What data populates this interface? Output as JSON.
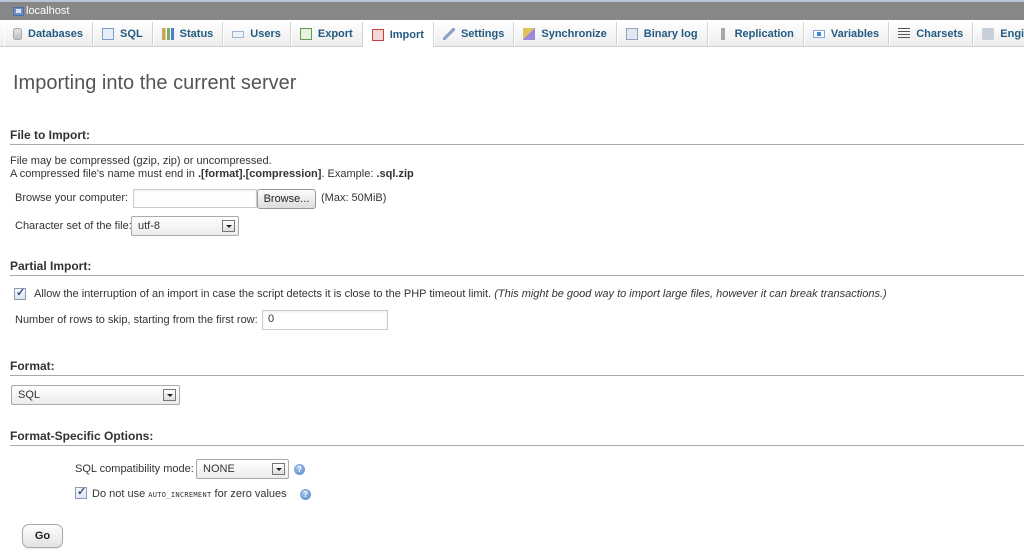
{
  "window": {
    "server_label": "localhost"
  },
  "tabs": [
    {
      "label": "Databases",
      "icon": "database-icon",
      "active": false
    },
    {
      "label": "SQL",
      "icon": "sql-icon",
      "active": false
    },
    {
      "label": "Status",
      "icon": "status-chart-icon",
      "active": false
    },
    {
      "label": "Users",
      "icon": "users-icon",
      "active": false
    },
    {
      "label": "Export",
      "icon": "export-icon",
      "active": false
    },
    {
      "label": "Import",
      "icon": "import-icon",
      "active": true
    },
    {
      "label": "Settings",
      "icon": "wrench-icon",
      "active": false
    },
    {
      "label": "Synchronize",
      "icon": "synchronize-icon",
      "active": false
    },
    {
      "label": "Binary log",
      "icon": "binary-log-icon",
      "active": false
    },
    {
      "label": "Replication",
      "icon": "replication-icon",
      "active": false
    },
    {
      "label": "Variables",
      "icon": "variables-icon",
      "active": false
    },
    {
      "label": "Charsets",
      "icon": "charsets-icon",
      "active": false
    },
    {
      "label": "Engines",
      "icon": "engines-icon",
      "active": false
    }
  ],
  "page": {
    "title": "Importing into the current server"
  },
  "file_to_import": {
    "heading": "File to Import:",
    "line1": "File may be compressed (gzip, zip) or uncompressed.",
    "line2_prefix": "A compressed file's name must end in ",
    "line2_bold": ".[format].[compression]",
    "line2_mid": ". Example: ",
    "line2_example": ".sql.zip",
    "browse_label": "Browse your computer:",
    "file_value": "",
    "browse_button": "Browse...",
    "max_size": "(Max: 50MiB)",
    "charset_label": "Character set of the file:",
    "charset_value": "utf-8"
  },
  "partial_import": {
    "heading": "Partial Import:",
    "allow_interrupt_checked": true,
    "allow_interrupt_label": "Allow the interruption of an import in case the script detects it is close to the PHP timeout limit.",
    "allow_interrupt_note": "(This might be good way to import large files, however it can break transactions.)",
    "skip_rows_label": "Number of rows to skip, starting from the first row:",
    "skip_rows_value": "0"
  },
  "format": {
    "heading": "Format:",
    "selected": "SQL"
  },
  "format_options": {
    "heading": "Format-Specific Options:",
    "compat_label": "SQL compatibility mode:",
    "compat_value": "NONE",
    "no_auto_inc_checked": true,
    "no_auto_inc_prefix": "Do not use ",
    "no_auto_inc_code": "AUTO_INCREMENT",
    "no_auto_inc_suffix": " for zero values",
    "help_glyph": "?"
  },
  "actions": {
    "go_label": "Go"
  }
}
